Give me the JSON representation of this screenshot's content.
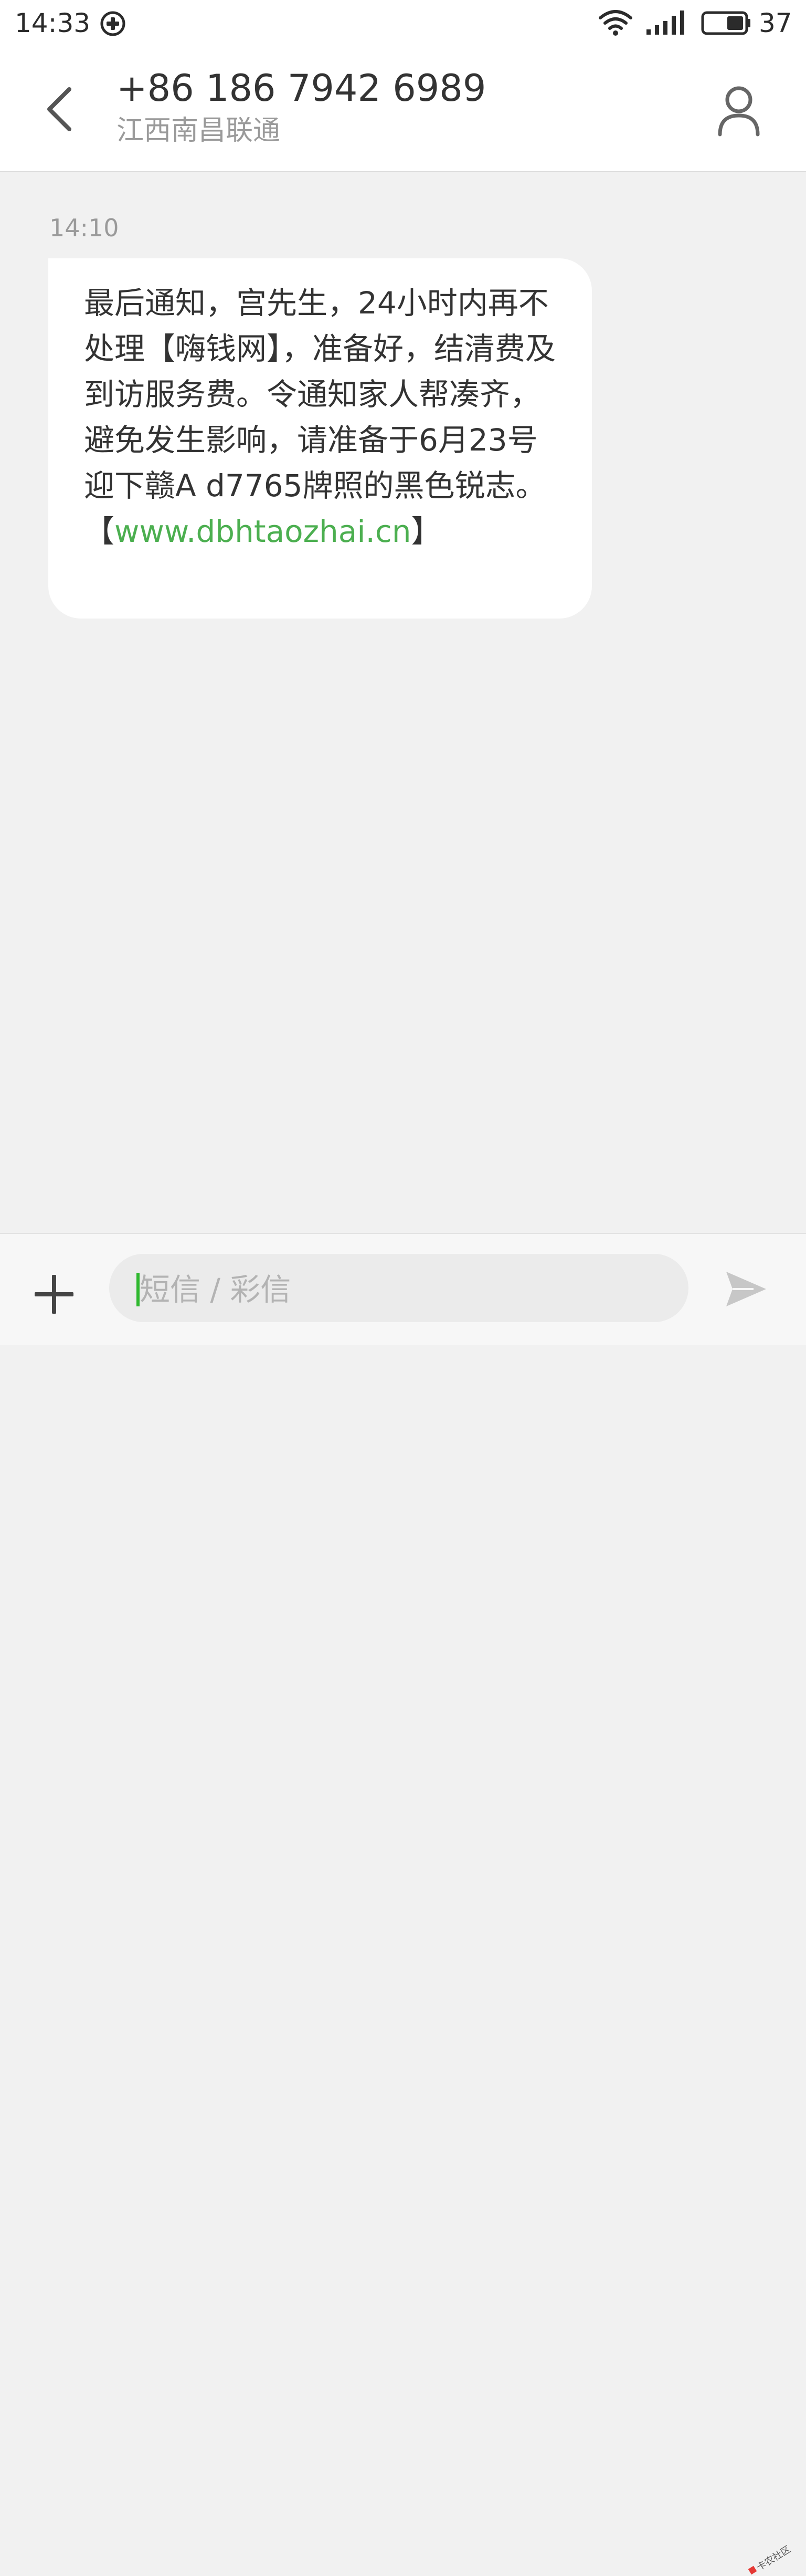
{
  "status_bar": {
    "time": "14:33",
    "app_icon": "circled-plus-icon",
    "wifi_icon": "wifi-icon",
    "signal_icon": "signal-bars-icon",
    "battery_icon": "battery-icon",
    "battery_level": "37"
  },
  "header": {
    "back_icon": "chevron-left-icon",
    "contact_number": "+86 186 7942 6989",
    "contact_location": "江西南昌联通",
    "contact_icon": "person-icon"
  },
  "conversation": {
    "messages": [
      {
        "time": "14:10",
        "text_before_link": "最后通知，宫先生，24小时内再不处理【嗨钱网】，准备好，结清费及到访服务费。令通知家人帮凑齐，避免发生影响，请准备于6月23号迎下赣A d7765牌照的黑色锐志。【",
        "link": "www.dbhtaozhai.cn",
        "text_after_link": "】"
      }
    ]
  },
  "input_bar": {
    "add_icon": "plus-icon",
    "placeholder": "短信 / 彩信",
    "send_icon": "send-icon",
    "watermark_text": "卡农社区"
  },
  "colors": {
    "accent_green": "#4caf50",
    "background": "#f1f1f1",
    "bubble": "#ffffff",
    "text_primary": "#333333",
    "text_secondary": "#9a9a9a"
  }
}
